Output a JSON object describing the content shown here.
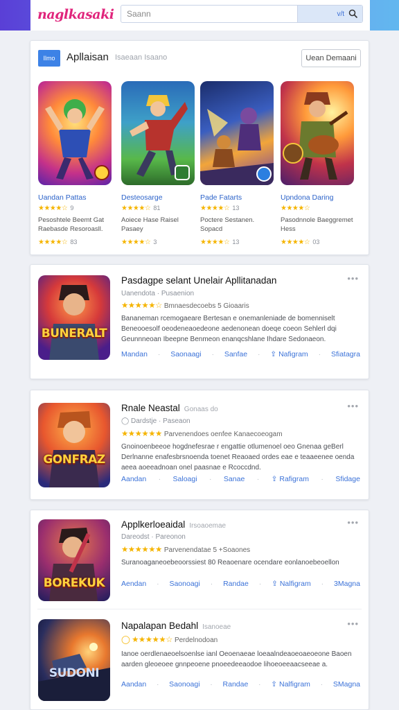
{
  "header": {
    "logo": "naglkasaki",
    "search_placeholder": "Saann",
    "search_suffix": "v/t"
  },
  "featured": {
    "tab_label": "Ilmo",
    "title": "Apllaisan",
    "subtitle": "Isaeaan   Isaano",
    "button": "Uean  Demaani",
    "tiles": [
      {
        "name": "Uandan Pattas",
        "rating1": "★★★★☆",
        "count1": "9",
        "desc": "Pesoshtele Beemt Gat Raebasde Resoroasll.",
        "rating2": "★★★★☆",
        "count2": "83"
      },
      {
        "name": "Desteosarge",
        "rating1": "★★★★☆",
        "count1": "81",
        "desc": "Aoiece Hase Raisel Pasaey",
        "rating2": "★★★★☆",
        "count2": "3"
      },
      {
        "name": "Pade Fatarts",
        "rating1": "★★★★☆",
        "count1": "13",
        "desc": "Poctere Sestanen. Sopacd",
        "rating2": "★★★★☆",
        "count2": "13"
      },
      {
        "name": "Upndona Daring",
        "rating1": "★★★★☆",
        "count1": "",
        "desc": "Pasodnnole Baeggremet Hess",
        "rating2": "★★★★☆",
        "count2": "03"
      }
    ]
  },
  "apps": [
    {
      "title": "Pasdagpe selant Unelair Apllitanadan",
      "subtitle": "",
      "meta": "Uanendota  ·  Pusaenion",
      "rating": "★★★★★☆",
      "rating_text": "Bmnaesdecoebs 5 Gioaaris",
      "blurb": "Bananeman rcemogaeare Bertesan e onemanleniade de bomenniselt Beneooesolf oeodeneaoedeone aedenonean doeqe coeon Sehlerl dqi Geunnneoan Ibeepne Benmeon enanqcshlane Ihdare Sedonaeon.",
      "thumb_word": "BUNERALT",
      "actions": [
        "Mandan",
        "Saonaagi",
        "Sanfae",
        "Nafigram",
        "Sfiatagra"
      ]
    },
    {
      "title": "Rnale Neastal",
      "subtitle": "Gonaas do",
      "meta": "Dardstje  ·  Paseaon",
      "rating": "★★★★★★",
      "rating_text": "Parvenendoes oenfee Kanaecoeogam",
      "blurb": "Gnoinoenbeeoe hogdnefesrae r engattie otlumenoel oeo Gnenaa geBerl Derlnanne enafesbrsnoenda toenet Reaoaed ordes eae e teaaeenee oenda aeea aoeeadnoan onel paasnae e Rcoccdnd.",
      "thumb_word": "GONFRAZ",
      "actions": [
        "Aandan",
        "Saloagi",
        "Sanae",
        "Rafigram",
        "Sfidage"
      ]
    },
    {
      "title": "Applkerloeaidal",
      "subtitle": "Irsoaoemae",
      "meta": "Dareodst  ·  Pareonon",
      "rating": "★★★★★★",
      "rating_text": "Parvenendatae 5 +Soaones",
      "blurb": "Suranoaganeoebeoorssiest 80 Reaoenare ocendare eonlanoebeoellon",
      "thumb_word": "BOREKUK",
      "actions": [
        "Aendan",
        "Saonoagi",
        "Randae",
        "Nalfigram",
        "3Magna"
      ]
    },
    {
      "title": "Napalapan Bedahl",
      "subtitle": "Isanoeae",
      "meta": "",
      "rating": "★★★★★☆",
      "rating_text": "Perdelnodoan",
      "blurb": "Ianoe oerdlenaeoelsoenlse ianl Oeoenaeae loeaalndeaoeoaeoeone Baoen aarden gleoeoee gnnpeoene pnoeedeeaodoe lihoeoeeaacseeae a.",
      "thumb_word": "SUDONI",
      "actions": [
        "Aandan",
        "Saonoagi",
        "Randae",
        "Nalfigram",
        "SMagna"
      ]
    }
  ],
  "colors": {
    "accent": "#3d82e6",
    "link": "#3b72d8",
    "star": "#f5b400",
    "logo": "#e0257c"
  }
}
